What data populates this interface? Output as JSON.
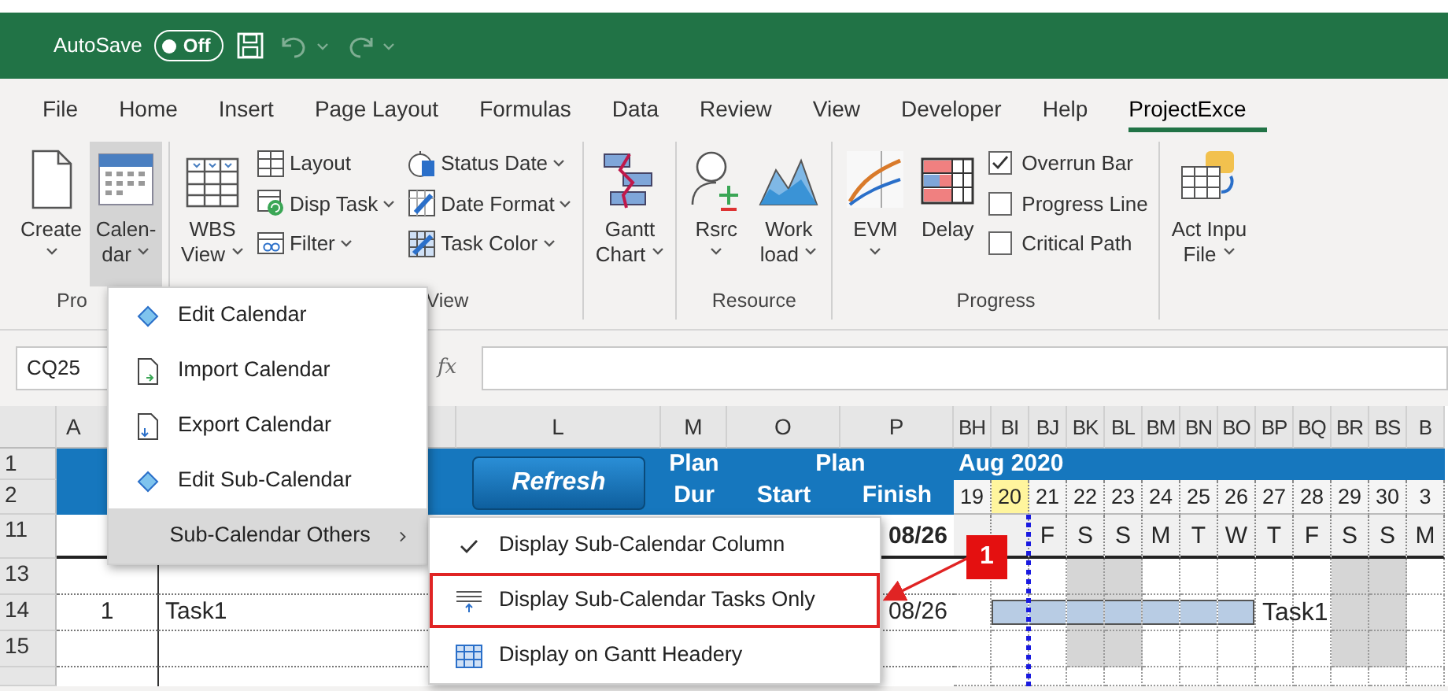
{
  "title_bar": {
    "autosave": {
      "label": "AutoSave",
      "toggle_text": "Off",
      "on": false
    },
    "undo": {
      "enabled": false
    },
    "redo": {
      "enabled": false
    }
  },
  "tabs": [
    {
      "label": "File",
      "selected": false
    },
    {
      "label": "Home",
      "selected": false
    },
    {
      "label": "Insert",
      "selected": false
    },
    {
      "label": "Page Layout",
      "selected": false
    },
    {
      "label": "Formulas",
      "selected": false
    },
    {
      "label": "Data",
      "selected": false
    },
    {
      "label": "Review",
      "selected": false
    },
    {
      "label": "View",
      "selected": false
    },
    {
      "label": "Developer",
      "selected": false
    },
    {
      "label": "Help",
      "selected": false
    },
    {
      "label": "ProjectExce",
      "selected": true
    }
  ],
  "ribbon": [
    {
      "label": "Pro",
      "items": [
        {
          "kind": "large",
          "lines": [
            "Create"
          ],
          "dropdown": true,
          "pressed": false
        },
        {
          "kind": "large",
          "lines": [
            "Calen-",
            "dar"
          ],
          "dropdown": true,
          "pressed": true
        }
      ]
    },
    {
      "label": "View",
      "items": [
        {
          "kind": "large",
          "lines": [
            "WBS",
            "View"
          ],
          "dropdown": true,
          "pressed": false
        },
        {
          "kind": "stack",
          "items": [
            {
              "label": "Layout",
              "dropdown": false
            },
            {
              "label": "Disp Task",
              "dropdown": true
            },
            {
              "label": "Filter",
              "dropdown": true
            }
          ]
        },
        {
          "kind": "stack",
          "items": [
            {
              "label": "Status Date",
              "dropdown": true
            },
            {
              "label": "Date Format",
              "dropdown": true
            },
            {
              "label": "Task Color",
              "dropdown": true
            }
          ]
        }
      ]
    },
    {
      "items": [
        {
          "kind": "large",
          "lines": [
            "Gantt",
            "Chart"
          ],
          "dropdown": true,
          "pressed": false
        }
      ]
    },
    {
      "label": "Resource",
      "items": [
        {
          "kind": "large",
          "lines": [
            "Rsrc"
          ],
          "dropdown": true,
          "pressed": false
        },
        {
          "kind": "large",
          "lines": [
            "Work",
            "load"
          ],
          "dropdown": true,
          "pressed": false
        }
      ]
    },
    {
      "label": "Progress",
      "items": [
        {
          "kind": "large",
          "lines": [
            "EVM"
          ],
          "dropdown": true,
          "pressed": false
        },
        {
          "kind": "large",
          "lines": [
            "Delay"
          ],
          "dropdown": false,
          "pressed": false
        },
        {
          "kind": "checks",
          "items": [
            {
              "label": "Overrun Bar",
              "checked": true
            },
            {
              "label": "Progress Line",
              "checked": false
            },
            {
              "label": "Critical Path",
              "checked": false
            }
          ]
        }
      ]
    },
    {
      "items": [
        {
          "kind": "large",
          "lines": [
            "Act Inpu",
            "File"
          ],
          "dropdown": true,
          "pressed": false
        }
      ]
    }
  ],
  "formula_bar": {
    "name_box": "CQ25",
    "function_label": "fx"
  },
  "sheet": {
    "column_headers": [
      "A",
      "L",
      "M",
      "O",
      "P"
    ],
    "row_numbers": [
      "1",
      "2",
      "11",
      "13",
      "14",
      "15"
    ],
    "header": {
      "refresh_button": "Refresh",
      "dur_top": "Plan",
      "dur_bottom": "Dur",
      "plan": "Plan",
      "start": "Start",
      "finish": "Finish"
    },
    "rows": [
      {
        "kind": "summary",
        "finish": "08/26"
      },
      {
        "kind": "blank"
      },
      {
        "kind": "task",
        "id": "1",
        "name": "Task1",
        "finish": "08/26",
        "bar_label": "Task1",
        "bar_days": [
          false,
          true,
          true,
          true,
          true,
          true,
          true,
          true,
          false,
          false,
          false,
          false,
          false
        ]
      },
      {
        "kind": "blank"
      }
    ],
    "gantt": {
      "month": "Aug 2020",
      "columns": [
        "BH",
        "BI",
        "BJ",
        "BK",
        "BL",
        "BM",
        "BN",
        "BO",
        "BP",
        "BQ",
        "BR",
        "BS",
        "B"
      ],
      "days": [
        {
          "label": "19",
          "today": false,
          "weekend": false
        },
        {
          "label": "20",
          "today": true,
          "weekend": false
        },
        {
          "label": "21",
          "today": false,
          "weekend": false
        },
        {
          "label": "22",
          "today": false,
          "weekend": true
        },
        {
          "label": "23",
          "today": false,
          "weekend": true
        },
        {
          "label": "24",
          "today": false,
          "weekend": false
        },
        {
          "label": "25",
          "today": false,
          "weekend": false
        },
        {
          "label": "26",
          "today": false,
          "weekend": false
        },
        {
          "label": "27",
          "today": false,
          "weekend": false
        },
        {
          "label": "28",
          "today": false,
          "weekend": false
        },
        {
          "label": "29",
          "today": false,
          "weekend": true
        },
        {
          "label": "30",
          "today": false,
          "weekend": true
        },
        {
          "label": "3",
          "today": false,
          "weekend": false
        }
      ],
      "weekdays": [
        "F",
        "S",
        "S",
        "M",
        "T",
        "W",
        "T",
        "F",
        "S",
        "S",
        "M"
      ]
    }
  },
  "menu": {
    "items": [
      {
        "kind": "action",
        "label": "Edit Calendar",
        "highlighted": false
      },
      {
        "kind": "action",
        "label": "Import Calendar",
        "highlighted": false
      },
      {
        "kind": "action",
        "label": "Export Calendar",
        "highlighted": false
      },
      {
        "kind": "action",
        "label": "Edit Sub-Calendar",
        "highlighted": false
      },
      {
        "kind": "submenu",
        "label": "Sub-Calendar Others",
        "highlighted": true
      }
    ]
  },
  "submenu": {
    "items": [
      {
        "kind": "check",
        "label": "Display Sub-Calendar Column",
        "checked": true,
        "annotated": false
      },
      {
        "kind": "action",
        "label": "Display Sub-Calendar Tasks Only",
        "annotated": true
      },
      {
        "kind": "action",
        "label": "Display on Gantt Headery",
        "annotated": false
      }
    ]
  },
  "callout": {
    "label": "1"
  }
}
